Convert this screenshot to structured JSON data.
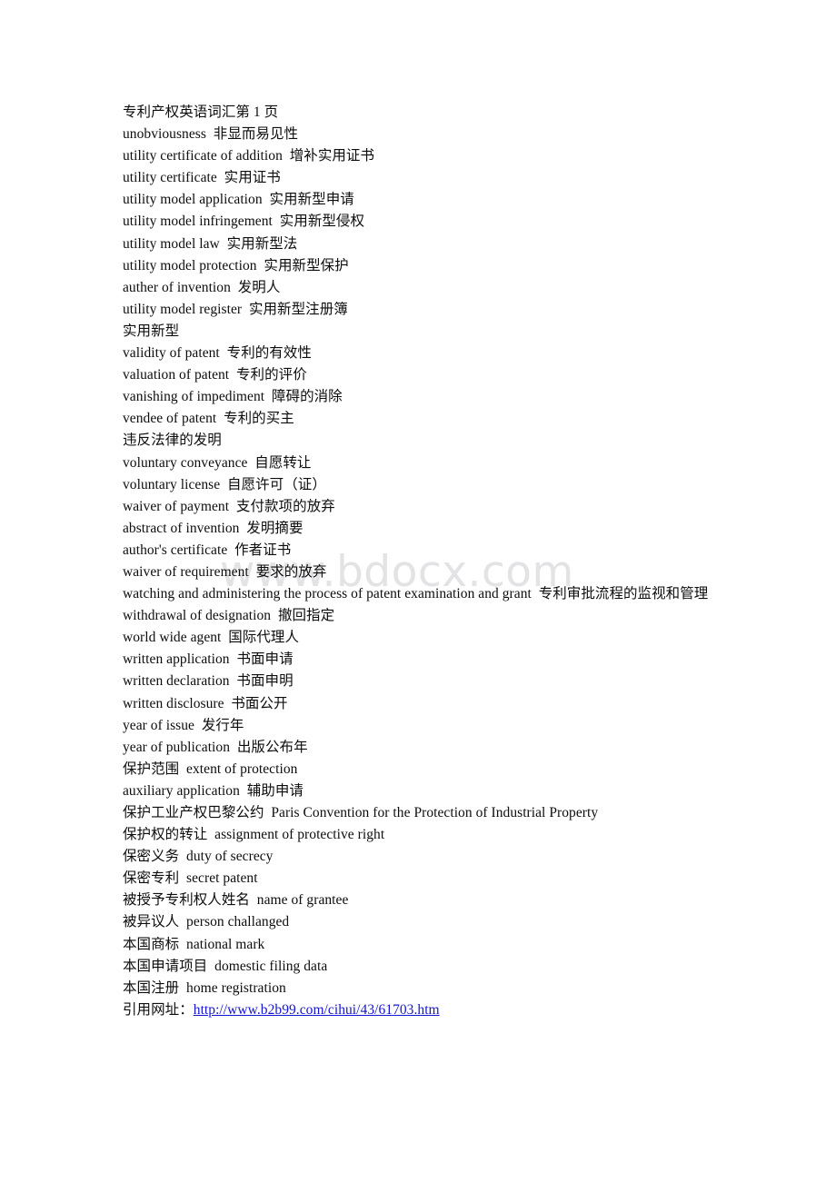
{
  "document": {
    "title": "专利产权英语词汇第 1 页",
    "watermark": "www.bdocx.com",
    "link_label": "引用网址：",
    "link_url": "http://www.b2b99.com/cihui/43/61703.htm",
    "link_color": "#1414d2",
    "text_color": "#0d0d0d",
    "background_color": "#ffffff",
    "watermark_color": "#e3e3e6",
    "lines": [
      "专利产权英语词汇第 1 页",
      "unobviousness  非显而易见性",
      "utility certificate of addition  增补实用证书",
      "utility certificate  实用证书",
      "utility model application  实用新型申请",
      "utility model infringement  实用新型侵权",
      "utility model law  实用新型法",
      "utility model protection  实用新型保护",
      "auther of invention  发明人",
      "utility model register  实用新型注册簿",
      "实用新型",
      "validity of patent  专利的有效性",
      "valuation of patent  专利的评价",
      "vanishing of impediment  障碍的消除",
      "vendee of patent  专利的买主",
      "违反法律的发明",
      "voluntary conveyance  自愿转让",
      "voluntary license  自愿许可（证）",
      "waiver of payment  支付款项的放弃",
      "abstract of invention  发明摘要",
      "author's certificate  作者证书",
      "waiver of requirement  要求的放弃",
      "watching and administering the process of patent examination and grant  专利审批流程的监视和管理",
      "withdrawal of designation  撤回指定",
      "world wide agent  国际代理人",
      "written application  书面申请",
      "written declaration  书面申明",
      "written disclosure  书面公开",
      "year of issue  发行年",
      "year of publication  出版公布年",
      "保护范围  extent of protection",
      "auxiliary application  辅助申请",
      "保护工业产权巴黎公约  Paris Convention for the Protection of Industrial Property",
      "保护权的转让  assignment of protective right",
      "保密义务  duty of secrecy",
      "保密专利  secret patent",
      "被授予专利权人姓名  name of grantee",
      "被异议人  person challanged",
      "本国商标  national mark",
      "本国申请项目  domestic filing data",
      "本国注册  home registration"
    ]
  }
}
